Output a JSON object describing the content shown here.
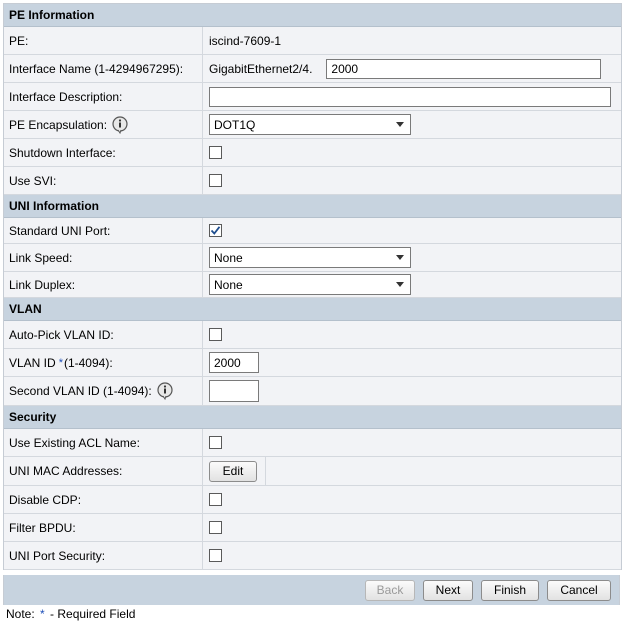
{
  "sections": {
    "pe": "PE Information",
    "uni": "UNI Information",
    "vlan": "VLAN",
    "security": "Security"
  },
  "pe": {
    "pe_label": "PE:",
    "pe_value": "iscind-7609-1",
    "interface_name_label": "Interface Name (1-4294967295):",
    "interface_name_prefix": "GigabitEthernet2/4.",
    "interface_name_value": "2000",
    "interface_description_label": "Interface Description:",
    "interface_description_value": "",
    "pe_encapsulation_label": "PE Encapsulation:",
    "pe_encapsulation_value": "DOT1Q",
    "shutdown_label": "Shutdown Interface:",
    "shutdown_checked": false,
    "use_svi_label": "Use SVI:",
    "use_svi_checked": false
  },
  "uni": {
    "standard_port_label": "Standard UNI Port:",
    "standard_port_checked": true,
    "link_speed_label": "Link Speed:",
    "link_speed_value": "None",
    "link_duplex_label": "Link Duplex:",
    "link_duplex_value": "None"
  },
  "vlan": {
    "auto_pick_label": "Auto-Pick VLAN ID:",
    "auto_pick_checked": false,
    "vlan_id_label": "VLAN ID",
    "vlan_id_required": "*",
    "vlan_id_range": "(1-4094):",
    "vlan_id_value": "2000",
    "second_vlan_label": "Second VLAN ID (1-4094):",
    "second_vlan_value": ""
  },
  "security": {
    "existing_acl_label": "Use Existing ACL Name:",
    "existing_acl_checked": false,
    "mac_addresses_label": "UNI MAC Addresses:",
    "edit_button": "Edit",
    "disable_cdp_label": "Disable CDP:",
    "disable_cdp_checked": false,
    "filter_bpdu_label": "Filter BPDU:",
    "filter_bpdu_checked": false,
    "port_security_label": "UNI Port Security:",
    "port_security_checked": false
  },
  "footer": {
    "back": "Back",
    "next": "Next",
    "finish": "Finish",
    "cancel": "Cancel"
  },
  "note": {
    "prefix": "Note:",
    "star": "*",
    "text": "- Required Field"
  },
  "figure_code": "238824",
  "colors": {
    "section_bg": "#c7d3df",
    "row_bg": "#f2f3f6",
    "required_star": "#1d4fb8"
  }
}
